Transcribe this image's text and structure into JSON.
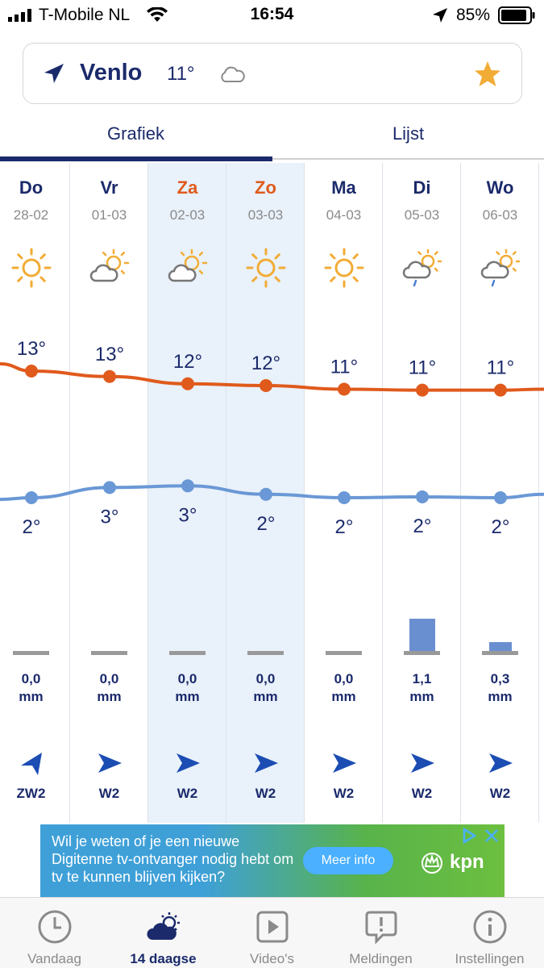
{
  "status_bar": {
    "carrier": "T-Mobile NL",
    "time": "16:54",
    "battery": "85%"
  },
  "location": {
    "city": "Venlo",
    "temperature": "11°",
    "condition_icon": "cloud-icon",
    "favorite_icon": "star-icon"
  },
  "tabs": [
    {
      "label": "Grafiek",
      "active": true
    },
    {
      "label": "Lijst",
      "active": false
    }
  ],
  "days": [
    {
      "name": "Do",
      "date": "28-02",
      "weekend": false,
      "icon": "sun-icon",
      "high": "13°",
      "low": "2°",
      "rain_value": "0,0",
      "rain_unit": "mm",
      "rain_mm": 0.0,
      "wind_icon": "wind-arrow-icon",
      "wind": "ZW2"
    },
    {
      "name": "Vr",
      "date": "01-03",
      "weekend": false,
      "icon": "partly-cloudy-icon",
      "high": "13°",
      "low": "3°",
      "rain_value": "0,0",
      "rain_unit": "mm",
      "rain_mm": 0.0,
      "wind_icon": "wind-arrow-icon",
      "wind": "W2"
    },
    {
      "name": "Za",
      "date": "02-03",
      "weekend": true,
      "icon": "partly-cloudy-icon",
      "high": "12°",
      "low": "3°",
      "rain_value": "0,0",
      "rain_unit": "mm",
      "rain_mm": 0.0,
      "wind_icon": "wind-arrow-icon",
      "wind": "W2"
    },
    {
      "name": "Zo",
      "date": "03-03",
      "weekend": true,
      "icon": "sun-icon",
      "high": "12°",
      "low": "2°",
      "rain_value": "0,0",
      "rain_unit": "mm",
      "rain_mm": 0.0,
      "wind_icon": "wind-arrow-icon",
      "wind": "W2"
    },
    {
      "name": "Ma",
      "date": "04-03",
      "weekend": false,
      "icon": "sun-icon",
      "high": "11°",
      "low": "2°",
      "rain_value": "0,0",
      "rain_unit": "mm",
      "rain_mm": 0.0,
      "wind_icon": "wind-arrow-icon",
      "wind": "W2"
    },
    {
      "name": "Di",
      "date": "05-03",
      "weekend": false,
      "icon": "rain-shower-icon",
      "high": "11°",
      "low": "2°",
      "rain_value": "1,1",
      "rain_unit": "mm",
      "rain_mm": 1.1,
      "wind_icon": "wind-arrow-icon",
      "wind": "W2"
    },
    {
      "name": "Wo",
      "date": "06-03",
      "weekend": false,
      "icon": "rain-shower-icon",
      "high": "11°",
      "low": "2°",
      "rain_value": "0,3",
      "rain_unit": "mm",
      "rain_mm": 0.3,
      "wind_icon": "wind-arrow-icon",
      "wind": "W2"
    }
  ],
  "chart_data": {
    "type": "line",
    "categories": [
      "Do",
      "Vr",
      "Za",
      "Zo",
      "Ma",
      "Di",
      "Wo"
    ],
    "series": [
      {
        "key": "high",
        "values": [
          13,
          13,
          12,
          12,
          11,
          11,
          11
        ],
        "labels": [
          "13°",
          "13°",
          "12°",
          "12°",
          "11°",
          "11°",
          "11°"
        ],
        "color": "#e05a1c",
        "plot_values": [
          13.3,
          13.0,
          12.6,
          12.5,
          12.3,
          12.25,
          12.25
        ],
        "edge_start": 13.7,
        "edge_end": 12.3
      },
      {
        "key": "low",
        "values": [
          2,
          3,
          3,
          2,
          2,
          2,
          2
        ],
        "labels": [
          "2°",
          "3°",
          "3°",
          "2°",
          "2°",
          "2°",
          "2°"
        ],
        "color": "#6a98d6",
        "plot_values": [
          2.3,
          2.9,
          3.0,
          2.5,
          2.3,
          2.35,
          2.3
        ],
        "edge_start": 2.2,
        "edge_end": 2.5
      }
    ],
    "rain": {
      "values": [
        0.0,
        0.0,
        0.0,
        0.0,
        0.0,
        1.1,
        0.3
      ],
      "color": "#6a8fd0"
    }
  },
  "ad": {
    "text": "Wil je weten of je een nieuwe Digitenne tv-ontvanger nodig hebt om tv te kunnen blijven kijken?",
    "button": "Meer info",
    "brand": "kpn"
  },
  "tabbar": [
    {
      "label": "Vandaag",
      "icon": "clock-icon",
      "active": false
    },
    {
      "label": "14 daagse",
      "icon": "weather-cloud-sun-icon",
      "active": true
    },
    {
      "label": "Video's",
      "icon": "video-play-icon",
      "active": false
    },
    {
      "label": "Meldingen",
      "icon": "alert-bubble-icon",
      "active": false
    },
    {
      "label": "Instellingen",
      "icon": "info-icon",
      "active": false
    }
  ]
}
